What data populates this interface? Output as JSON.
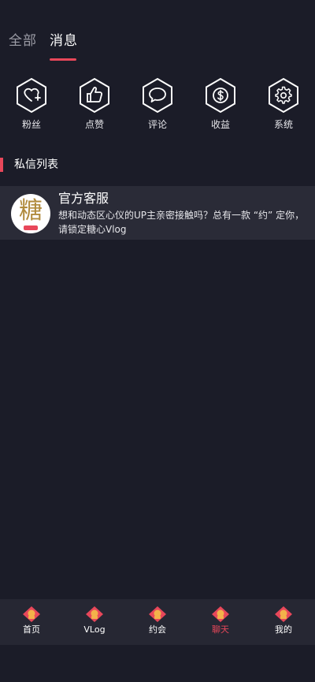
{
  "tabs": [
    {
      "label": "全部",
      "active": false
    },
    {
      "label": "消息",
      "active": true
    }
  ],
  "categories": [
    {
      "label": "粉丝",
      "icon": "heart-plus-icon"
    },
    {
      "label": "点赞",
      "icon": "thumbs-up-icon"
    },
    {
      "label": "评论",
      "icon": "speech-bubble-icon"
    },
    {
      "label": "收益",
      "icon": "dollar-coin-icon"
    },
    {
      "label": "系统",
      "icon": "gear-icon"
    }
  ],
  "section": {
    "title": "私信列表"
  },
  "messages": [
    {
      "name": "官方客服",
      "avatar_char": "糖",
      "text": "想和动态区心仪的UP主亲密接触吗？总有一款 “约” 定你，请锁定糖心Vlog"
    }
  ],
  "bottom_nav": [
    {
      "label": "首页",
      "active": false
    },
    {
      "label": "VLog",
      "active": false
    },
    {
      "label": "约会",
      "active": false
    },
    {
      "label": "聊天",
      "active": true
    },
    {
      "label": "我的",
      "active": false
    }
  ],
  "colors": {
    "background": "#1b1c28",
    "accent": "#e8475a",
    "nav_background": "#262733",
    "item_background": "#2a2b37"
  }
}
